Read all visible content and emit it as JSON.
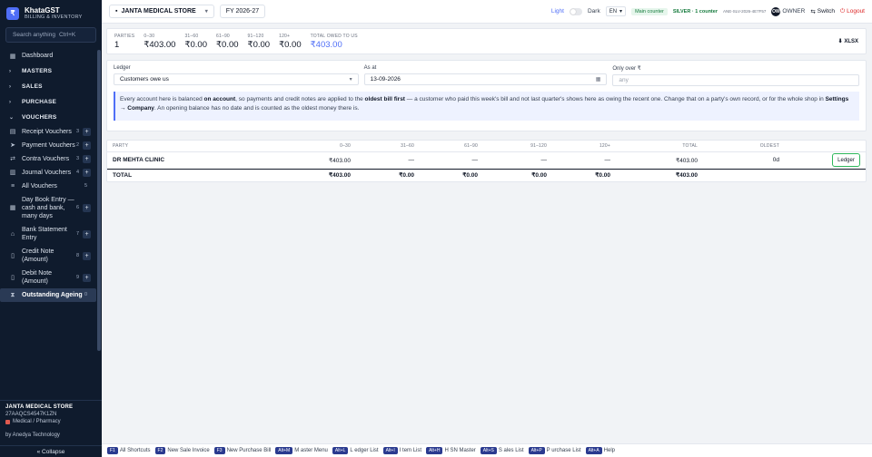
{
  "brand": {
    "name": "KhataGST",
    "subtitle": "BILLING & INVENTORY",
    "logo_glyph": "₹"
  },
  "search": {
    "placeholder": "Search anything",
    "shortcut": "Ctrl+K"
  },
  "sidebar": {
    "dashboard": "Dashboard",
    "groups": {
      "masters": "MASTERS",
      "sales": "SALES",
      "purchase": "PURCHASE",
      "vouchers": "VOUCHERS"
    },
    "vouchers": [
      {
        "label": "Receipt Vouchers",
        "key": "3",
        "plus": "+"
      },
      {
        "label": "Payment Vouchers",
        "key": "2",
        "plus": "+"
      },
      {
        "label": "Contra Vouchers",
        "key": "3",
        "plus": "+"
      },
      {
        "label": "Journal Vouchers",
        "key": "4",
        "plus": "+"
      },
      {
        "label": "All Vouchers",
        "key": "5"
      },
      {
        "label": "Day Book Entry — cash and bank, many days",
        "key": "6",
        "plus": "+"
      },
      {
        "label": "Bank Statement Entry",
        "key": "7",
        "plus": "+"
      },
      {
        "label": "Credit Note (Amount)",
        "key": "8",
        "plus": "+"
      },
      {
        "label": "Debit Note (Amount)",
        "key": "9",
        "plus": "+"
      },
      {
        "label": "Outstanding Ageing",
        "key": "0"
      }
    ],
    "footer": {
      "store": "JANTA MEDICAL STORE",
      "gstin": "27AAQCS4547K1ZN",
      "category": "Medical / Pharmacy",
      "by": "by Anedya Technology",
      "collapse": "« Collapse"
    }
  },
  "topbar": {
    "store": "JANTA MEDICAL STORE",
    "fy": "FY 2026-27",
    "light": "Light",
    "dark": "Dark",
    "lang": "EN",
    "counter": "Main counter",
    "plan": "SILVER · 1 counter",
    "plan_code": "ANE-SLV-2026-4E7F57",
    "owner_badge": "OW",
    "owner": "OWNER",
    "switch": "Switch",
    "logout": "Logout"
  },
  "summary": {
    "cells": [
      {
        "label": "PARTIES",
        "value": "1"
      },
      {
        "label": "0–30",
        "value": "₹403.00"
      },
      {
        "label": "31–60",
        "value": "₹0.00"
      },
      {
        "label": "61–90",
        "value": "₹0.00"
      },
      {
        "label": "91–120",
        "value": "₹0.00"
      },
      {
        "label": "120+",
        "value": "₹0.00"
      },
      {
        "label": "TOTAL OWED TO US",
        "value": "₹403.00"
      }
    ],
    "xlsx": "⬇ XLSX"
  },
  "filters": {
    "ledger_label": "Ledger",
    "ledger_value": "Customers owe us",
    "asat_label": "As at",
    "asat_value": "13-09-2026",
    "only_label": "Only over ₹",
    "only_placeholder": "any",
    "info_1": "Every account here is balanced ",
    "info_b1": "on account",
    "info_2": ", so payments and credit notes are applied to the ",
    "info_b2": "oldest bill first",
    "info_3": " — a customer who paid this week's bill and not last quarter's shows here as owing the recent one. Change that on a party's own record, or for the whole shop in ",
    "info_b3": "Settings → Company",
    "info_4": ". An opening balance has no date and is counted as the oldest money there is."
  },
  "table": {
    "headers": [
      "PARTY",
      "0–30",
      "31–60",
      "61–90",
      "91–120",
      "120+",
      "TOTAL",
      "OLDEST",
      ""
    ],
    "row": {
      "party": "DR MEHTA CLINIC",
      "b0": "₹403.00",
      "b1": "—",
      "b2": "—",
      "b3": "—",
      "b4": "—",
      "total": "₹403.00",
      "oldest": "0d",
      "action": "Ledger"
    },
    "total_row": {
      "label": "TOTAL",
      "b0": "₹403.00",
      "b1": "₹0.00",
      "b2": "₹0.00",
      "b3": "₹0.00",
      "b4": "₹0.00",
      "total": "₹403.00"
    }
  },
  "shortcuts": [
    {
      "key": "F1",
      "label": "All Shortcuts"
    },
    {
      "key": "F2",
      "label": "New Sale Invoice"
    },
    {
      "key": "F3",
      "label": "New Purchase Bill"
    },
    {
      "key": "Alt+M",
      "label": "M aster Menu"
    },
    {
      "key": "Alt+L",
      "label": "L edger List"
    },
    {
      "key": "Alt+I",
      "label": "I tem List"
    },
    {
      "key": "Alt+H",
      "label": "H SN Master"
    },
    {
      "key": "Alt+S",
      "label": "S ales List"
    },
    {
      "key": "Alt+P",
      "label": "P urchase List"
    },
    {
      "key": "Alt+A",
      "label": "Help"
    }
  ]
}
